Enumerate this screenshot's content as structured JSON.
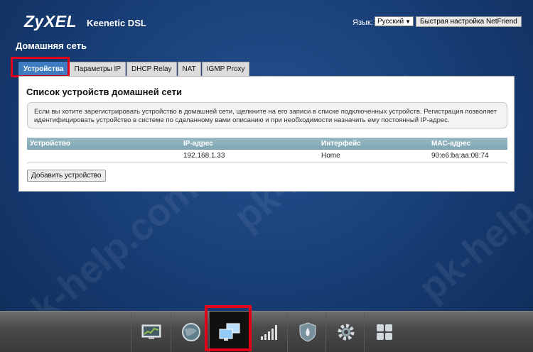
{
  "header": {
    "brand": "ZyXEL",
    "model": "Keenetic DSL",
    "language_label": "Язык:",
    "language_value": "Русский",
    "quick_setup_label": "Быстрая настройка NetFriend"
  },
  "page_title": "Домашняя сеть",
  "tabs": [
    {
      "label": "Устройства",
      "active": true
    },
    {
      "label": "Параметры IP",
      "active": false
    },
    {
      "label": "DHCP Relay",
      "active": false
    },
    {
      "label": "NAT",
      "active": false
    },
    {
      "label": "IGMP Proxy",
      "active": false
    }
  ],
  "panel": {
    "title": "Список устройств домашней сети",
    "info_text": "Если вы хотите зарегистрировать устройство в домашней сети, щелкните на его записи в списке подключенных устройств. Регистрация позволяет идентифицировать устройство в системе по сделанному вами описанию и при необходимости назначить ему постоянный IP-адрес.",
    "columns": [
      "Устройство",
      "IP-адрес",
      "Интерфейс",
      "MAC-адрес"
    ],
    "rows": [
      [
        "",
        "192.168.1.33",
        "Home",
        "90:e6:ba:aa:08:74"
      ]
    ],
    "add_button_label": "Добавить устройство"
  },
  "dock": {
    "items": [
      {
        "icon": "monitor-chart-icon"
      },
      {
        "icon": "globe-icon"
      },
      {
        "icon": "home-network-icon",
        "active": true
      },
      {
        "icon": "signal-bars-icon"
      },
      {
        "icon": "shield-flame-icon"
      },
      {
        "icon": "gear-icon"
      },
      {
        "icon": "apps-grid-icon"
      }
    ]
  },
  "colors": {
    "background": "#173c73",
    "active_tab": "#3f7dc0",
    "highlight": "#e2001a",
    "table_header": "#8aafbc"
  }
}
